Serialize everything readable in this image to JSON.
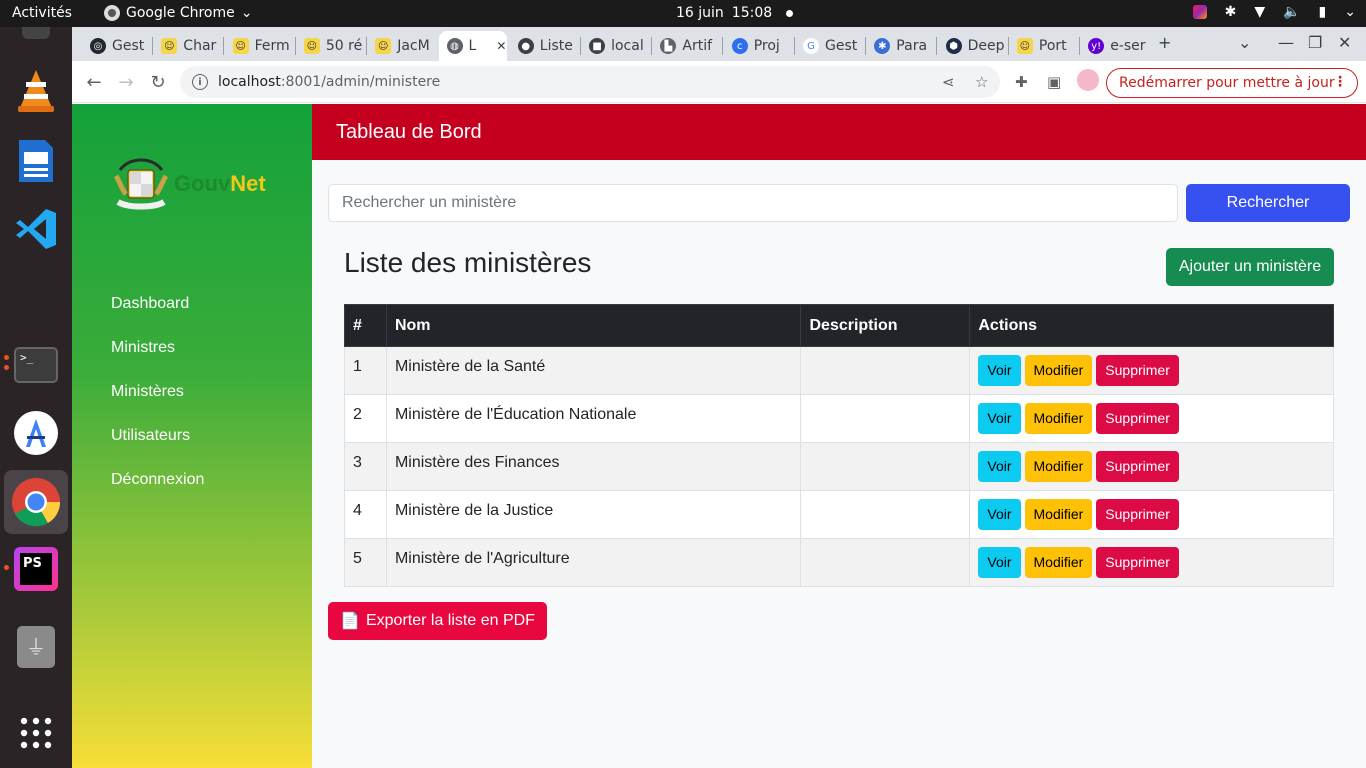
{
  "topbar": {
    "activities": "Activités",
    "app_name": "Google Chrome",
    "date": "16 juin",
    "time": "15:08"
  },
  "dock": {
    "items": [
      "terminal-top",
      "vlc",
      "writer",
      "vscode",
      "terminal",
      "android-studio",
      "chrome",
      "phpstorm",
      "usb",
      "app-grid"
    ]
  },
  "browser": {
    "tabs": [
      {
        "label": "Gest",
        "icon": "github"
      },
      {
        "label": "Char",
        "icon": "emoji"
      },
      {
        "label": "Ferm",
        "icon": "emoji"
      },
      {
        "label": "50 ré",
        "icon": "emoji"
      },
      {
        "label": "JacM",
        "icon": "emoji"
      },
      {
        "label": "L",
        "icon": "globe",
        "active": true
      },
      {
        "label": "Liste",
        "icon": "dot"
      },
      {
        "label": "local",
        "icon": "square"
      },
      {
        "label": "Artif",
        "icon": "city"
      },
      {
        "label": "Proj",
        "icon": "c"
      },
      {
        "label": "Gest",
        "icon": "google"
      },
      {
        "label": "Para",
        "icon": "gear"
      },
      {
        "label": "Deep",
        "icon": "hex"
      },
      {
        "label": "Port",
        "icon": "emoji"
      },
      {
        "label": "e-ser",
        "icon": "yahoo"
      }
    ],
    "url_host": "localhost",
    "url_path": ":8001/admin/ministere",
    "relaunch_label": "Redémarrer pour mettre à jour"
  },
  "sidebar": {
    "brand_part1": "Gouv",
    "brand_part2": "Net",
    "links": [
      "Dashboard",
      "Ministres",
      "Ministères",
      "Utilisateurs",
      "Déconnexion"
    ]
  },
  "header": {
    "title": "Tableau de Bord"
  },
  "search": {
    "placeholder": "Rechercher un ministère",
    "button": "Rechercher"
  },
  "list": {
    "title": "Liste des ministères",
    "add_button": "Ajouter un ministère",
    "columns": [
      "#",
      "Nom",
      "Description",
      "Actions"
    ],
    "rows": [
      {
        "id": "1",
        "name": "Ministère de la Santé",
        "description": ""
      },
      {
        "id": "2",
        "name": "Ministère de l'Éducation Nationale",
        "description": ""
      },
      {
        "id": "3",
        "name": "Ministère des Finances",
        "description": ""
      },
      {
        "id": "4",
        "name": "Ministère de la Justice",
        "description": ""
      },
      {
        "id": "5",
        "name": "Ministère de l'Agriculture",
        "description": ""
      }
    ],
    "actions": {
      "view": "Voir",
      "edit": "Modifier",
      "delete": "Supprimer"
    }
  },
  "export_button": "Exporter la liste en PDF",
  "colors": {
    "header_red": "#c4001e",
    "search_blue": "#3750f0",
    "add_green": "#178c50",
    "view_cyan": "#0dcaf0",
    "edit_yellow": "#ffc107",
    "delete_red": "#dc0a45"
  }
}
